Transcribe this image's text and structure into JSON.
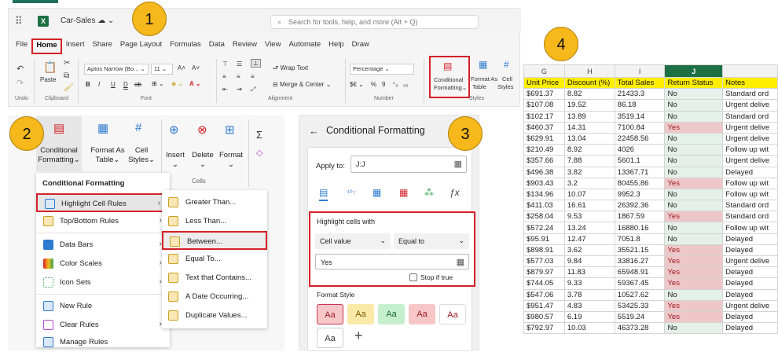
{
  "badges": [
    "1",
    "2",
    "3",
    "4"
  ],
  "ribbon": {
    "doc_name": "Car-Sales",
    "search_placeholder": "Search for tools, help, and more (Alt + Q)",
    "tabs": [
      "File",
      "Home",
      "Insert",
      "Share",
      "Page Layout",
      "Formulas",
      "Data",
      "Review",
      "View",
      "Automate",
      "Help",
      "Draw"
    ],
    "undo_label": "Undo",
    "paste_label": "Paste",
    "clipboard_label": "Clipboard",
    "font_name": "Aptos Narrow (Bo...",
    "font_size": "11",
    "font_label": "Font",
    "wrap_text": "Wrap Text",
    "merge_center": "Merge & Center",
    "alignment_label": "Alignment",
    "number_format": "Percentage",
    "number_label": "Number",
    "cond_fmt_line1": "Conditional",
    "cond_fmt_line2": "Formatting",
    "format_as_line1": "Format As",
    "format_as_line2": "Table",
    "cell_line1": "Cell",
    "cell_line2": "Styles",
    "styles_label": "Styles"
  },
  "panel2": {
    "cond_line1": "Conditional",
    "cond_line2": "Formatting",
    "format_as_line1": "Format As",
    "format_as_line2": "Table",
    "cell_line1": "Cell",
    "cell_line2": "Styles",
    "insert": "Insert",
    "delete": "Delete",
    "format": "Format",
    "cells_label": "Cells",
    "menu_title": "Conditional Formatting",
    "menu_items": [
      "Highlight Cell Rules",
      "Top/Bottom Rules",
      "Data Bars",
      "Color Scales",
      "Icon Sets",
      "New Rule",
      "Clear Rules",
      "Manage Rules"
    ],
    "submenu_items": [
      "Greater Than...",
      "Less Than...",
      "Between...",
      "Equal To...",
      "Text that Contains...",
      "A Date Occurring...",
      "Duplicate Values..."
    ]
  },
  "panel3": {
    "title": "Conditional Formatting",
    "apply_to_label": "Apply to:",
    "apply_to_value": "J:J",
    "highlight_label": "Highlight cells with",
    "rule_type": "Cell value",
    "operator": "Equal to",
    "value": "Yes",
    "stop_if_true": "Stop if true",
    "format_style_label": "Format Style",
    "swatch_text": "Aa",
    "add_symbol": "+"
  },
  "sheet": {
    "col_letters": [
      "G",
      "H",
      "I",
      "J",
      ""
    ],
    "headers": [
      "Unit Price",
      "Discount (%)",
      "Total Sales",
      "Return Status",
      "Notes"
    ],
    "rows": [
      [
        "$691.37",
        "8.82",
        "21433.3",
        "No",
        "Standard ord"
      ],
      [
        "$107.08",
        "19.52",
        "86.18",
        "No",
        "Urgent delive"
      ],
      [
        "$102.17",
        "13.89",
        "3519.14",
        "No",
        "Standard ord"
      ],
      [
        "$460.37",
        "14.31",
        "7100.84",
        "Yes",
        "Urgent delive"
      ],
      [
        "$629.91",
        "13.04",
        "22458.56",
        "No",
        "Urgent delive"
      ],
      [
        "$210.49",
        "8.92",
        "4026",
        "No",
        "Follow up wit"
      ],
      [
        "$357.66",
        "7.88",
        "5601.1",
        "No",
        "Urgent delive"
      ],
      [
        "$496.38",
        "3.82",
        "13367.71",
        "No",
        "Delayed"
      ],
      [
        "$903.43",
        "3.2",
        "80455.86",
        "Yes",
        "Follow up wit"
      ],
      [
        "$134.96",
        "10.07",
        "9952.3",
        "No",
        "Follow up wit"
      ],
      [
        "$411.03",
        "16.61",
        "26392.36",
        "No",
        "Standard ord"
      ],
      [
        "$258.04",
        "9.53",
        "1867.59",
        "Yes",
        "Standard ord"
      ],
      [
        "$572.24",
        "13.24",
        "16880.16",
        "No",
        "Follow up wit"
      ],
      [
        "$95.91",
        "12.47",
        "7051.8",
        "No",
        "Delayed"
      ],
      [
        "$898.91",
        "3.62",
        "35521.15",
        "Yes",
        "Delayed"
      ],
      [
        "$577.03",
        "9.84",
        "33816.27",
        "Yes",
        "Urgent delive"
      ],
      [
        "$879.97",
        "11.83",
        "65948.91",
        "Yes",
        "Delayed"
      ],
      [
        "$744.05",
        "9.33",
        "59367.45",
        "Yes",
        "Delayed"
      ],
      [
        "$547.06",
        "3.78",
        "10527.62",
        "No",
        "Delayed"
      ],
      [
        "$951.47",
        "4.83",
        "53425.33",
        "Yes",
        "Urgent delive"
      ],
      [
        "$980.57",
        "6.19",
        "5519.24",
        "Yes",
        "Delayed"
      ],
      [
        "$792.97",
        "10.03",
        "46373.28",
        "No",
        "Delayed"
      ]
    ]
  },
  "colors": {
    "excel_green": "#1d7044",
    "highlight_red": "#d42128",
    "badge": "#f6b81b",
    "header_yellow": "#ffee00",
    "yes_fill": "#eec7c8",
    "no_fill": "#e5f0e8"
  }
}
